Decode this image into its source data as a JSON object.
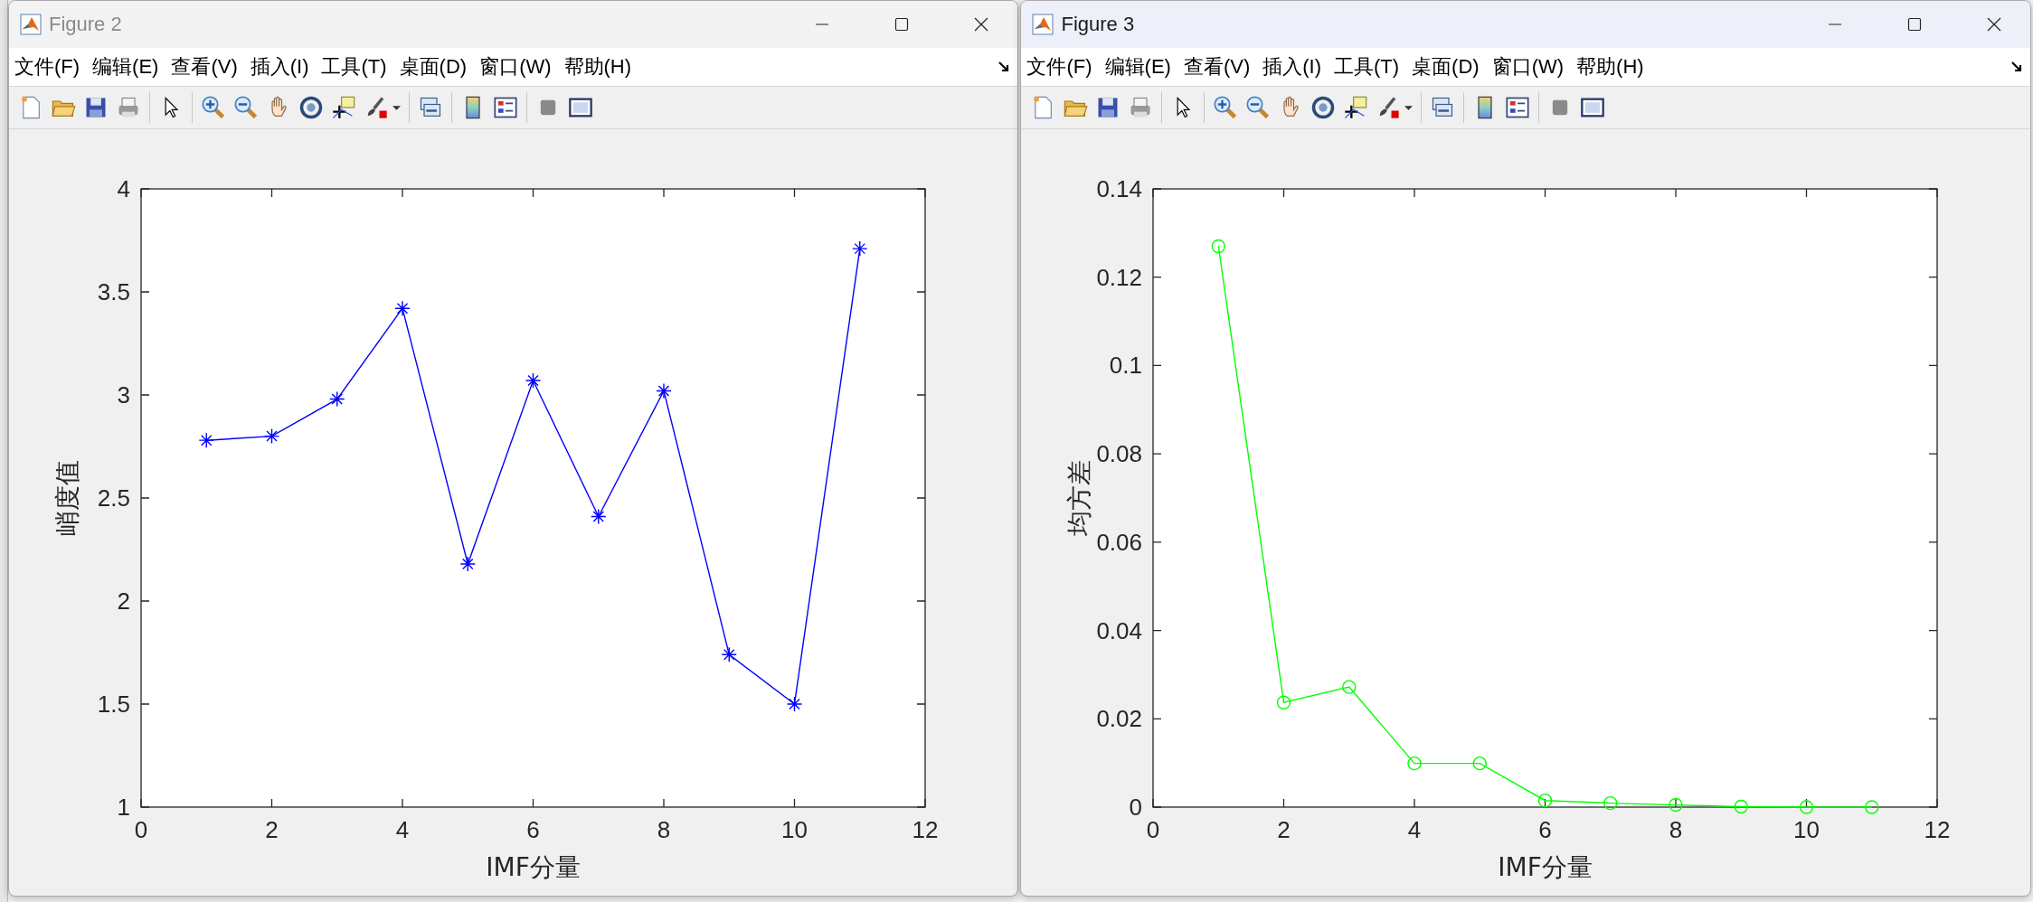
{
  "windows": [
    {
      "title": "Figure 2",
      "active": false,
      "menus": [
        "文件(F)",
        "编辑(E)",
        "查看(V)",
        "插入(I)",
        "工具(T)",
        "桌面(D)",
        "窗口(W)",
        "帮助(H)"
      ],
      "chart_data": {
        "type": "line",
        "xlabel": "IMF分量",
        "ylabel": "峭度值",
        "x": [
          1,
          2,
          3,
          4,
          5,
          6,
          7,
          8,
          9,
          10,
          11
        ],
        "series": [
          {
            "color": "#0000ff",
            "marker": "cross",
            "values": [
              2.78,
              2.8,
              2.98,
              3.42,
              2.18,
              3.07,
              2.41,
              3.02,
              1.74,
              1.5,
              3.71
            ]
          }
        ],
        "xlim": [
          0,
          12
        ],
        "ylim": [
          1,
          4
        ],
        "xticks": [
          0,
          2,
          4,
          6,
          8,
          10,
          12
        ],
        "yticks": [
          1,
          1.5,
          2,
          2.5,
          3,
          3.5,
          4
        ]
      }
    },
    {
      "title": "Figure 3",
      "active": true,
      "menus": [
        "文件(F)",
        "编辑(E)",
        "查看(V)",
        "插入(I)",
        "工具(T)",
        "桌面(D)",
        "窗口(W)",
        "帮助(H)"
      ],
      "chart_data": {
        "type": "line",
        "xlabel": "IMF分量",
        "ylabel": "均方差",
        "x": [
          1,
          2,
          3,
          4,
          5,
          6,
          7,
          8,
          9,
          10,
          11
        ],
        "series": [
          {
            "color": "#00ff00",
            "marker": "circle",
            "values": [
              0.127,
              0.0237,
              0.0272,
              0.0099,
              0.0099,
              0.0015,
              0.0009,
              0.0005,
              0.0001,
              0,
              0
            ]
          }
        ],
        "xlim": [
          0,
          12
        ],
        "ylim": [
          0,
          0.14
        ],
        "xticks": [
          0,
          2,
          4,
          6,
          8,
          10,
          12
        ],
        "yticks": [
          0,
          0.02,
          0.04,
          0.06,
          0.08,
          0.1,
          0.12,
          0.14
        ]
      }
    }
  ]
}
